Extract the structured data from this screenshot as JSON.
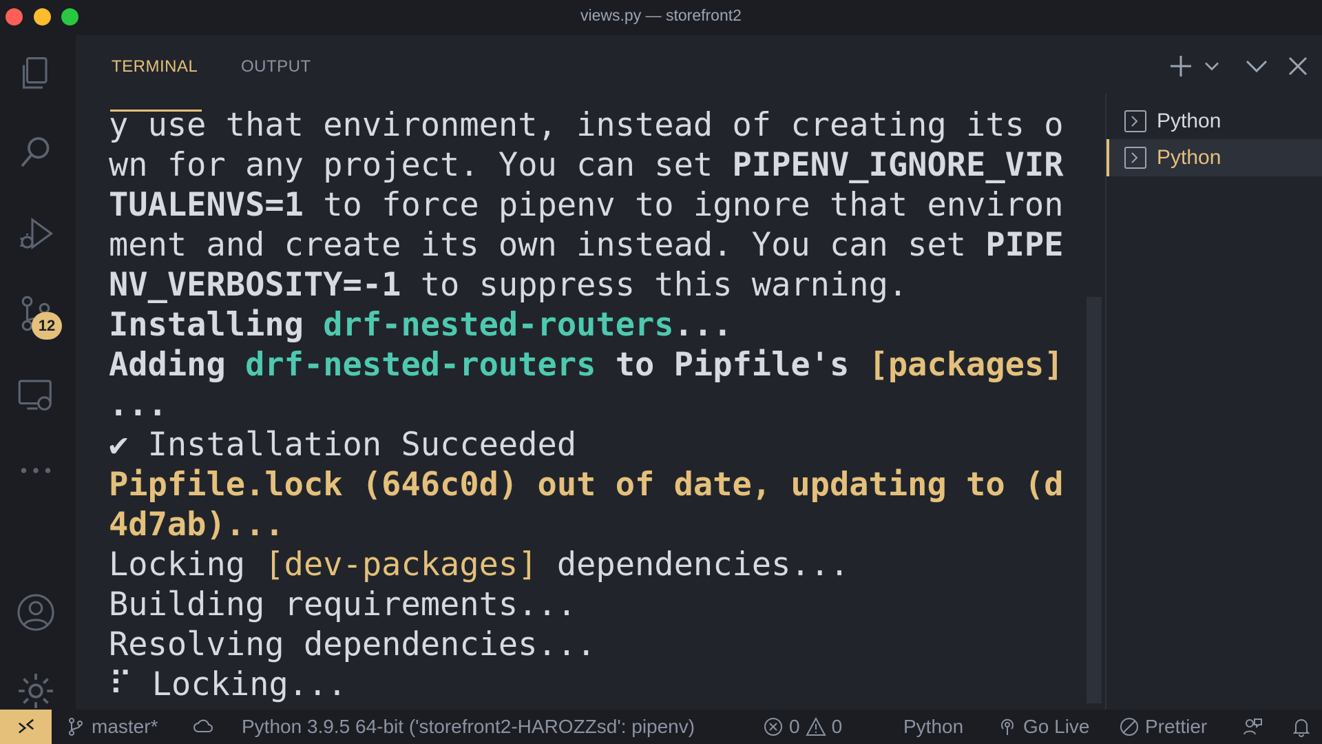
{
  "window": {
    "title": "views.py — storefront2"
  },
  "activity_bar": {
    "source_control_badge": "12"
  },
  "panel": {
    "tabs": [
      {
        "label": "TERMINAL",
        "active": true
      },
      {
        "label": "OUTPUT",
        "active": false
      }
    ]
  },
  "terminal": {
    "lines": {
      "l1": "y use that environment, instead of creating its o",
      "l2a": "wn for any project. You can set ",
      "l2b": "PIPENV_IGNORE_VIR",
      "l3a": "TUALENVS=1",
      "l3b": " to force pipenv to ignore that environ",
      "l4a": "ment and create its own instead. You can set ",
      "l4b": "PIPE",
      "l5a": "NV_VERBOSITY=-1",
      "l5b": " to suppress this warning.",
      "l6a": "Installing ",
      "l6b": "drf-nested-routers",
      "l6c": "...",
      "l7a": "Adding ",
      "l7b": "drf-nested-routers",
      "l7c": " to Pipfile's ",
      "l7d": "[packages]",
      "l8": "...",
      "l9": "✔ Installation Succeeded",
      "l10": "Pipfile.lock (646c0d) out of date, updating to (d",
      "l11": "4d7ab)...",
      "l12a": "Locking ",
      "l12b": "[dev-packages]",
      "l12c": " dependencies...",
      "l13": "Building requirements...",
      "l14": "Resolving dependencies...",
      "l15": "⠏ Locking..."
    }
  },
  "terminal_list": [
    {
      "label": "Python",
      "active": false
    },
    {
      "label": "Python",
      "active": true
    }
  ],
  "status_bar": {
    "branch": "master*",
    "interpreter": "Python 3.9.5 64-bit ('storefront2-HAROZZsd': pipenv)",
    "errors": "0",
    "warnings": "0",
    "language": "Python",
    "go_live": "Go Live",
    "prettier": "Prettier"
  },
  "colors": {
    "accent": "#e5c07b",
    "package_green": "#4ec9b0",
    "background": "#21252b"
  }
}
